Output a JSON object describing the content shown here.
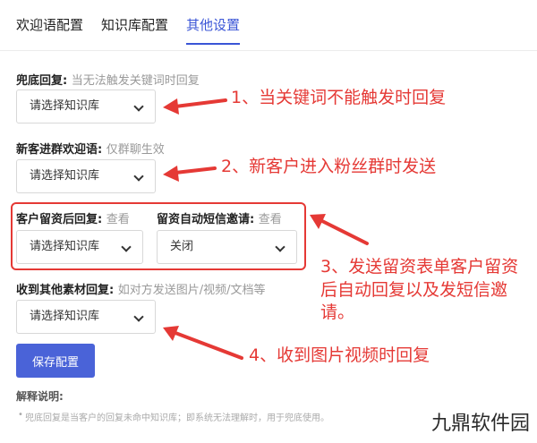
{
  "tabs": [
    {
      "label": "欢迎语配置",
      "active": false
    },
    {
      "label": "知识库配置",
      "active": false
    },
    {
      "label": "其他设置",
      "active": true
    }
  ],
  "fields": {
    "fallback": {
      "label": "兜底回复:",
      "hint": "当无法触发关键词时回复",
      "value": "请选择知识库"
    },
    "newcomer": {
      "label": "新客进群欢迎语:",
      "hint": "仅群聊生效",
      "value": "请选择知识库"
    },
    "lead_reply": {
      "label": "客户留资后回复:",
      "hint": "查看",
      "value": "请选择知识库"
    },
    "sms_invite": {
      "label": "留资自动短信邀请:",
      "hint": "查看",
      "value": "关闭"
    },
    "other_material": {
      "label": "收到其他素材回复:",
      "hint": "如对方发送图片/视频/文档等",
      "value": "请选择知识库"
    }
  },
  "save_label": "保存配置",
  "explain": {
    "title": "解释说明:",
    "text": "兜底回复是当客户的回复未命中知识库；即系统无法理解时，用于兜底使用。"
  },
  "annotations": {
    "a1": "1、当关键词不能触发时回复",
    "a2": "2、新客户进入粉丝群时发送",
    "a3": "3、发送留资表单客户留资后自动回复以及发短信邀请。",
    "a4": "4、收到图片视频时回复"
  },
  "watermark": "九鼎软件园",
  "colors": {
    "accent": "#3a55d6",
    "annotation": "#e53935",
    "button": "#4a63d8"
  }
}
